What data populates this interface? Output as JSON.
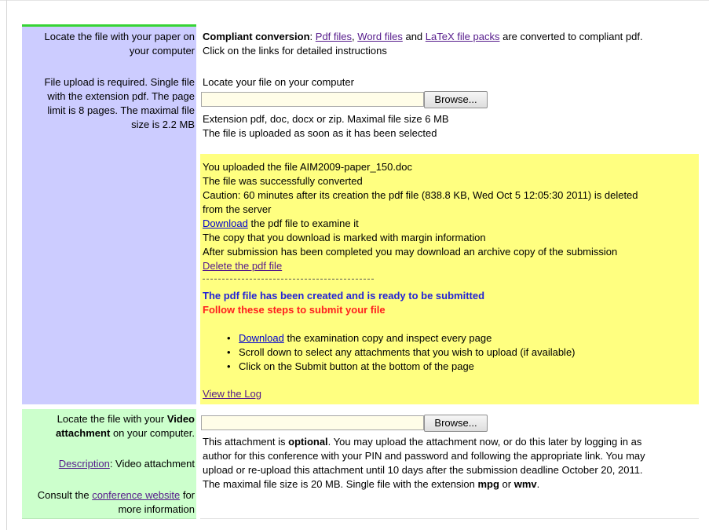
{
  "upload_row": {
    "left_title_line1": "Locate the file with your paper on",
    "left_title_line2": "your computer",
    "left_req_line1": "File upload is required. Single file",
    "left_req_line2": "with the extension pdf. The page",
    "left_req_line3": "limit is 8 pages. The maximal file",
    "left_req_line4": "size is 2.2 MB",
    "conversion": {
      "label": "Compliant conversion",
      "colon": ":",
      "pdf_link": "Pdf files",
      "comma": ",",
      "word_link": "Word files",
      "and": "and",
      "latex_link": "LaTeX file packs",
      "tail": "are converted to compliant pdf.",
      "line2": "Click on the links for detailed instructions"
    },
    "locate_label": "Locate your file on your computer",
    "file_input_value": "",
    "browse_label": "Browse...",
    "ext_note": "Extension pdf, doc, docx or zip. Maximal file size 6 MB",
    "upload_note": "The file is uploaded as soon as it has been selected"
  },
  "status_box": {
    "uploaded_line": "You uploaded the file AIM2009-paper_150.doc",
    "converted_line": "The file was successfully converted",
    "caution_line1": "Caution: 60 minutes after its creation the pdf file (838.8 KB, Wed Oct 5 12:05:30 2011) is deleted",
    "caution_line2": "from the server",
    "download_link": "Download",
    "download_tail": "the pdf file to examine it",
    "margin_note": "The copy that you download is marked with margin information",
    "archive_note": "After submission has been completed you may download an archive copy of the submission",
    "delete_link": "Delete the pdf file",
    "ready_line": "The pdf file has been created and is ready to be submitted",
    "follow_line": "Follow these steps to submit your file",
    "steps": {
      "step1_link": "Download",
      "step1_tail": "the examination copy and inspect every page",
      "step2": "Scroll down to select any attachments that you wish to upload (if available)",
      "step3": "Click on the Submit button at the bottom of the page"
    },
    "view_log_link": "View the Log"
  },
  "video_row": {
    "left_line1_pre": "Locate the file with your",
    "left_line1_bold": "Video",
    "left_line2_bold": "attachment",
    "left_line2_post": "on your computer.",
    "description_link": "Description",
    "description_tail": ": Video attachment",
    "consult_pre": "Consult the",
    "conference_link": "conference website",
    "consult_post": "for",
    "more_info": "more information",
    "file_input_value": "",
    "browse_label": "Browse...",
    "desc_line1_pre": "This attachment is",
    "desc_line1_bold": "optional",
    "desc_line1_post": ". You may upload the attachment now, or do this later by logging in as",
    "desc_line2": "author for this conference with your PIN and password and following the appropriate link. You may",
    "desc_line3": "upload or re-upload this attachment until 10 days after the submission deadline October 20, 2011.",
    "desc_line4_pre": "The maximal file size is 20 MB. Single file with the extension",
    "desc_line4_mpg": "mpg",
    "desc_line4_or": "or",
    "desc_line4_wmv": "wmv",
    "desc_line4_end": "."
  },
  "colors": {
    "upload_left_bg": "#ccccff",
    "video_left_bg": "#ccffcc",
    "status_bg": "#ffff80",
    "accent": "#37d435",
    "ready_text": "#2323d6",
    "follow_text": "#ff1f1f"
  }
}
